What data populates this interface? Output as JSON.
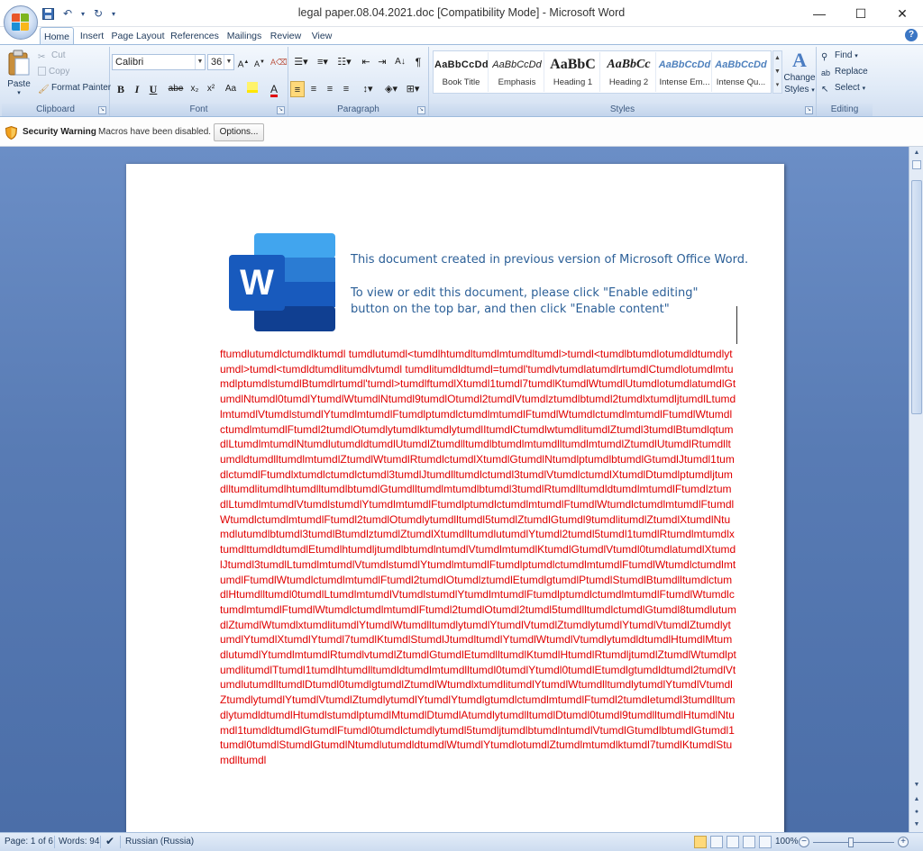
{
  "window": {
    "title": "legal paper.08.04.2021.doc [Compatibility Mode] - Microsoft Word",
    "controls": [
      "minimize",
      "maximize",
      "close"
    ]
  },
  "ribbon": {
    "tabs": [
      "Home",
      "Insert",
      "Page Layout",
      "References",
      "Mailings",
      "Review",
      "View"
    ],
    "active_tab": "Home",
    "clipboard": {
      "paste": "Paste",
      "cut": "Cut",
      "copy": "Copy",
      "format_painter": "Format Painter",
      "label": "Clipboard"
    },
    "font": {
      "name": "Calibri",
      "size": "36",
      "label": "Font",
      "buttons": [
        "B",
        "I",
        "U",
        "abe",
        "x₂",
        "x²",
        "Aa"
      ]
    },
    "paragraph": {
      "label": "Paragraph"
    },
    "styles": {
      "label": "Styles",
      "items": [
        {
          "sample": "AaBbCcDd",
          "name": "Book Title"
        },
        {
          "sample": "AaBbCcDd",
          "name": "Emphasis"
        },
        {
          "sample": "AaBbC",
          "name": "Heading 1"
        },
        {
          "sample": "AaBbCc",
          "name": "Heading 2"
        },
        {
          "sample": "AaBbCcDd",
          "name": "Intense Em..."
        },
        {
          "sample": "AaBbCcDd",
          "name": "Intense Qu..."
        }
      ],
      "change_styles_1": "Change",
      "change_styles_2": "Styles"
    },
    "editing": {
      "find": "Find",
      "replace": "Replace",
      "select": "Select",
      "label": "Editing"
    }
  },
  "security_bar": {
    "label": "Security Warning",
    "message": "Macros have been disabled.",
    "options_button": "Options..."
  },
  "document": {
    "notice_line1": "This document created in previous version of Microsoft Office Word.",
    "notice_line2": "To view or edit this document, please click \"Enable editing\" button on the top bar, and then click \"Enable content\"",
    "logo_letter": "W",
    "body_text": "ftumdlutumdlctumdlktumdl tumdlutumdl<tumdlhtumdltumdlmtumdltumdl>tumdl<tumdlbtumdlotumdldtumdlytumdl>tumdl<tumdldtumdlitumdlvtumdl tumdlitumdldtumdl=tumdl'tumdlvtumdlatumdlrtumdlCtumdlotumdlmtumdlptumdlstumdlBtumdlrtumdl'tumdl>tumdlftumdlXtumdl1tumdl7tumdlKtumdlWtumdlUtumdlotumdlatumdlGtumdlNtumdl0tumdlYtumdlWtumdlNtumdl9tumdlOtumdl2tumdlVtumdlztumdlbtumdl2tumdlxtumdljtumdlLtumdlmtumdlVtumdlstumdlYtumdlmtumdlFtumdlptumdlctumdlmtumdlFtumdlWtumdlctumdlmtumdlFtumdlWtumdlctumdlmtumdlFtumdl2tumdlOtumdlytumdlktumdlytumdlItumdlCtumdlwtumdlitumdlZtumdl3tumdlBtumdlqtumdlLtumdlmtumdlNtumdlutumdldtumdlUtumdlZtumdlltumdlbtumdlmtumdlltumdlmtumdlZtumdlUtumdlRtumdlltumdldtumdlltumdlmtumdlZtumdlWtumdlRtumdlctumdlXtumdlGtumdlNtumdlptumdlbtumdlGtumdlJtumdl1tumdlctumdlFtumdlxtumdlctumdlctumdl3tumdlJtumdlltumdlctumdl3tumdlVtumdlctumdlXtumdlDtumdlptumdljtumdlltumdlitumdlhtumdlltumdlbtumdlGtumdlltumdlmtumdlbtumdl3tumdlRtumdlltumdldtumdlmtumdlFtumdlztumdlLtumdlmtumdlVtumdlstumdlYtumdlmtumdlFtumdlptumdlctumdlmtumdlFtumdlWtumdlctumdlmtumdlFtumdlWtumdlctumdlmtumdlFtumdl2tumdlOtumdlytumdlltumdl5tumdlZtumdlGtumdl9tumdlitumdlZtumdlXtumdlNtumdlutumdlbtumdl3tumdlBtumdlztumdlZtumdlXtumdlltumdlutumdlYtumdl2tumdl5tumdl1tumdlRtumdlmtumdlxtumdlttumdldtumdlEtumdlhtumdljtumdlbtumdlntumdlVtumdlmtumdlKtumdlGtumdlVtumdl0tumdlatumdlXtumdlJtumdl3tumdlLtumdlmtumdlVtumdlstumdlYtumdlmtumdlFtumdlptumdlctumdlmtumdlFtumdlWtumdlctumdlmtumdlFtumdlWtumdlctumdlmtumdlFtumdl2tumdlOtumdlztumdlEtumdlgtumdlPtumdlStumdlBtumdlltumdlctumdlHtumdlltumdl0tumdlLtumdlmtumdlVtumdlstumdlYtumdlmtumdlFtumdlptumdlctumdlmtumdlFtumdlWtumdlctumdlmtumdlFtumdlWtumdlctumdlmtumdlFtumdl2tumdlOtumdl2tumdl5tumdlltumdlctumdlGtumdl8tumdlutumdlZtumdlWtumdlxtumdlitumdlYtumdlWtumdlltumdlytumdlYtumdlVtumdlZtumdlytumdlYtumdlVtumdlZtumdlytumdlYtumdlXtumdlYtumdl7tumdlKtumdlStumdlJtumdltumdlYtumdlWtumdlVtumdlytumdldtumdlHtumdlMtumdlutumdlYtumdlmtumdlRtumdlvtumdlZtumdlGtumdlEtumdlltumdlKtumdlHtumdlRtumdljtumdlZtumdlWtumdlptumdlitumdlTtumdl1tumdlhtumdlltumdldtumdlmtumdlltumdl0tumdlYtumdl0tumdlEtumdlgtumdldtumdl2tumdlVtumdlutumdlltumdlDtumdl0tumdlgtumdlZtumdlWtumdlxtumdlitumdlYtumdlWtumdlltumdlytumdlYtumdlVtumdlZtumdlytumdlYtumdlVtumdlZtumdlytumdlYtumdlYtumdlgtumdlctumdlmtumdlFtumdl2tumdletumdl3tumdlltumdlytumdldtumdlHtumdlstumdlptumdlMtumdlDtumdlAtumdlytumdlltumdlDtumdl0tumdl9tumdlltumdlHtumdlNtumdl1tumdldtumdlGtumdlFtumdl0tumdlctumdlytumdl5tumdljtumdlbtumdlntumdlVtumdlGtumdlbtumdlGtumdl1tumdl0tumdlStumdlGtumdlNtumdlutumdldtumdlWtumdlYtumdlotumdlZtumdlmtumdlktumdl7tumdlKtumdlStumdlltumdl"
  },
  "status_bar": {
    "page": "Page: 1 of 6",
    "words": "Words: 94",
    "language": "Russian (Russia)",
    "zoom": "100%"
  },
  "colors": {
    "document_background": "#587bb4",
    "warning_text": "#e00000",
    "notice_text": "#2b5f97"
  }
}
